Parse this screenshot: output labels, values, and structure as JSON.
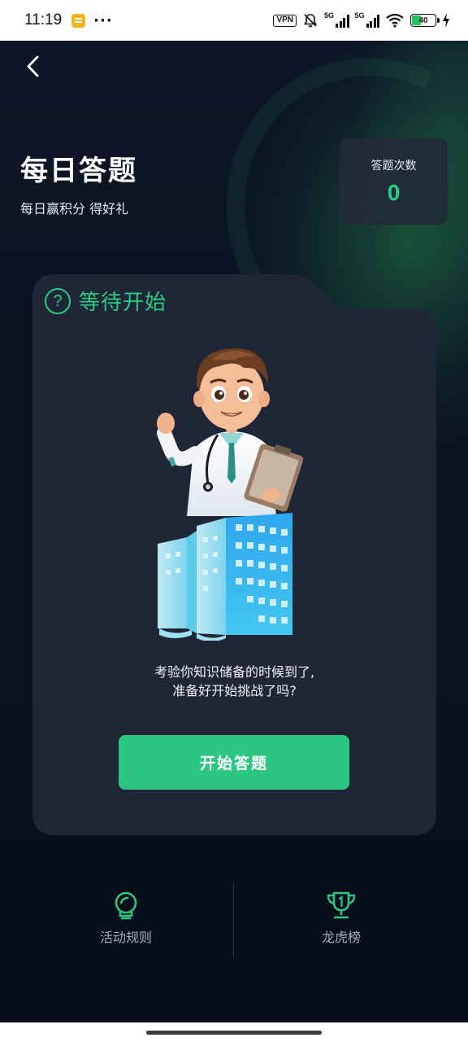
{
  "status_bar": {
    "time": "11:19",
    "dots": "···",
    "vpn": "VPN",
    "signal1_label": "5G",
    "signal2_label": "5G",
    "battery_level": "40",
    "icons": [
      "notes-app-icon",
      "vpn-icon",
      "mute-bell-icon",
      "signal-icon",
      "wifi-icon",
      "battery-icon",
      "charging-icon"
    ]
  },
  "header": {
    "title": "每日答题",
    "subtitle": "每日赢积分 得好礼"
  },
  "count_card": {
    "label": "答题次数",
    "value": "0"
  },
  "quiz_card": {
    "status": "等待开始",
    "description_line1": "考验你知识储备的时候到了,",
    "description_line2": "准备好开始挑战了吗?",
    "start_button": "开始答题"
  },
  "bottom_actions": [
    {
      "label": "活动规则",
      "icon": "rules-lightbulb-icon"
    },
    {
      "label": "龙虎榜",
      "icon": "trophy-icon"
    }
  ],
  "colors": {
    "accent": "#2bc782",
    "background": "#0b1220",
    "card": "#1f2635"
  }
}
